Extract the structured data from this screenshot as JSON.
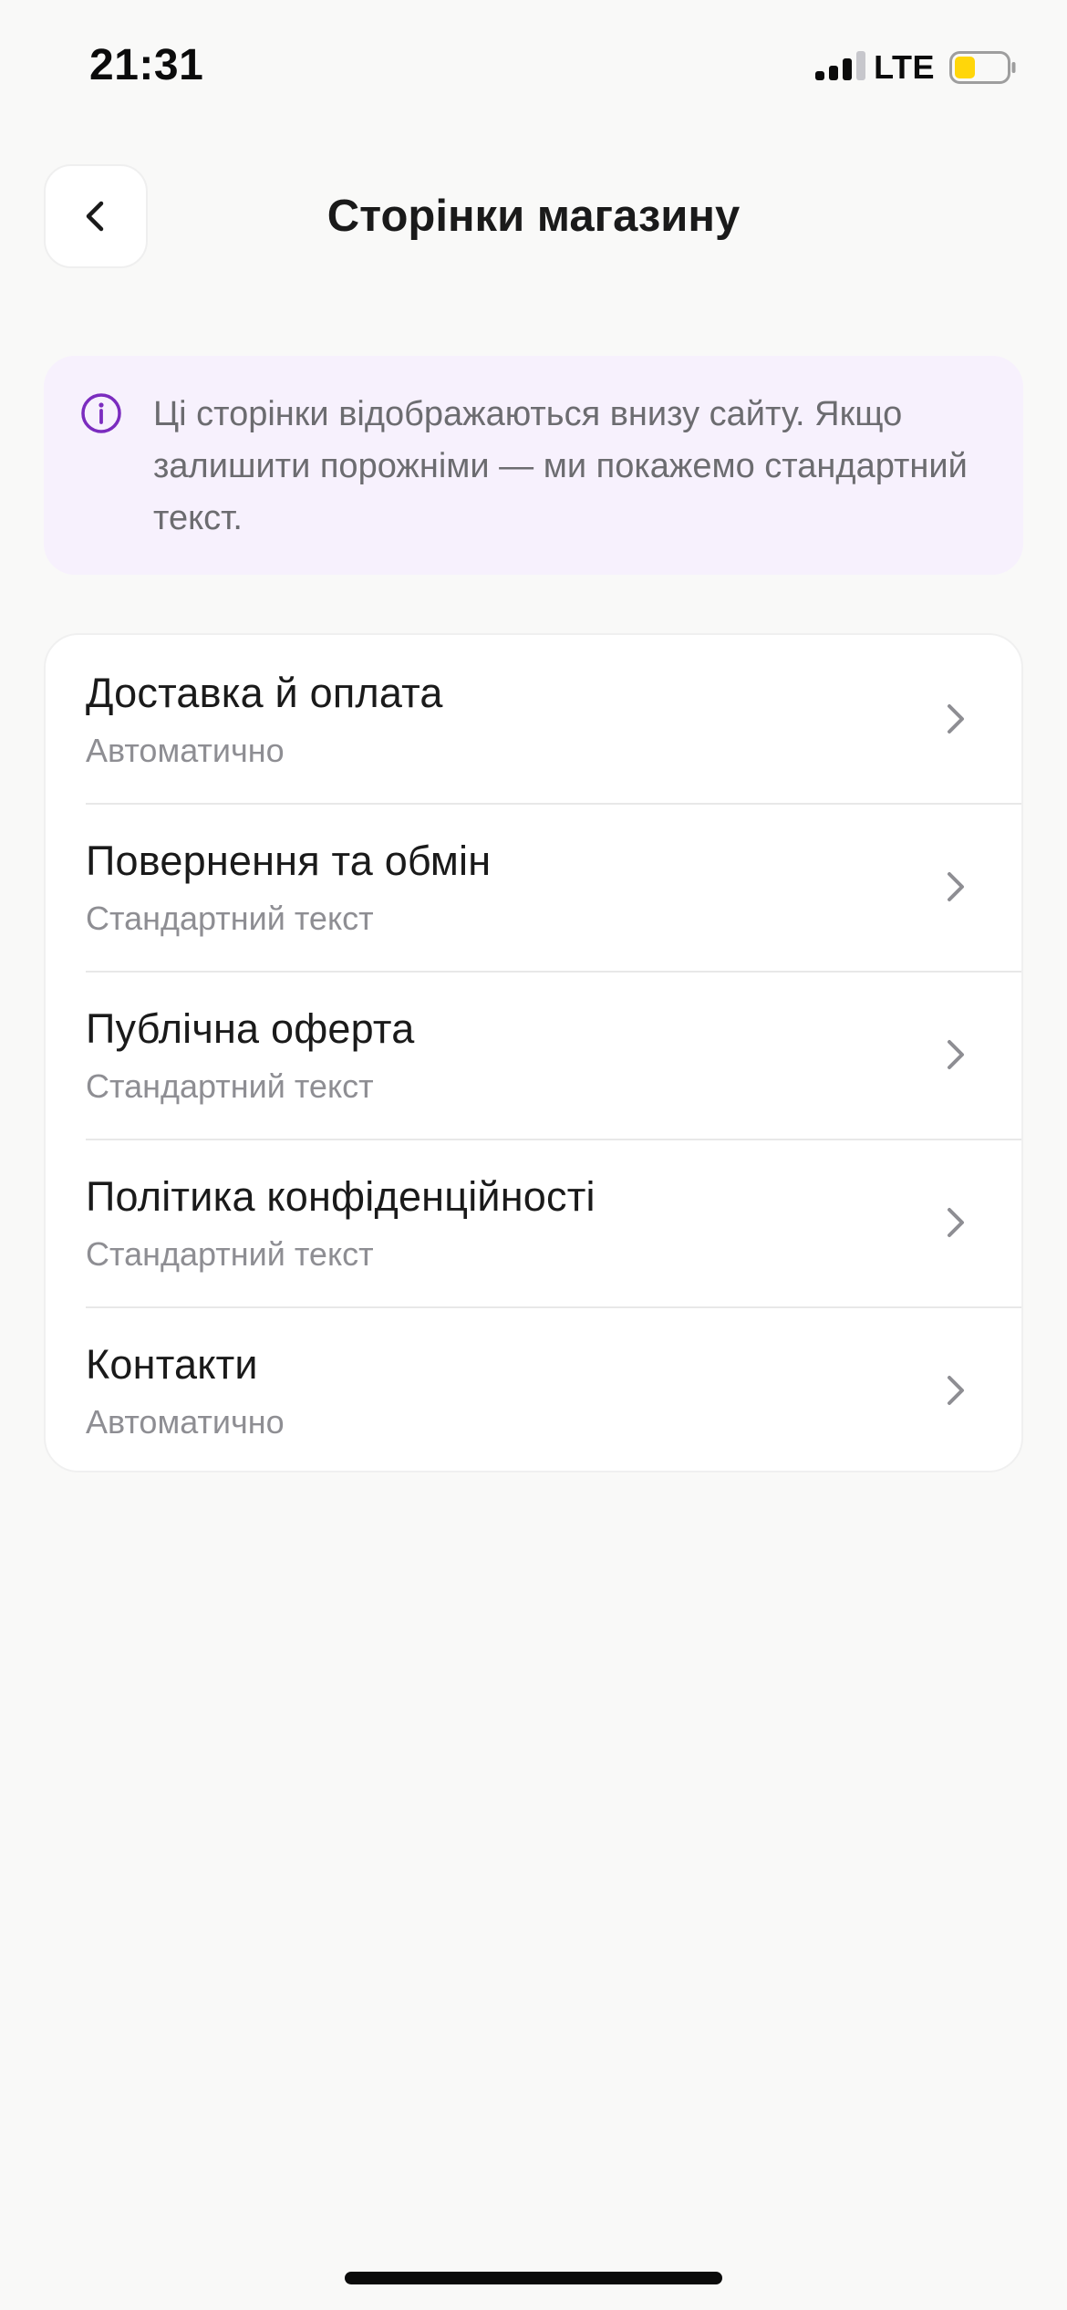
{
  "status_bar": {
    "time": "21:31",
    "network": "LTE",
    "icons": [
      "signal-icon",
      "battery-icon"
    ],
    "battery_color": "#FFD60A"
  },
  "header": {
    "back_icon": "chevron-left-icon",
    "title": "Сторінки магазину"
  },
  "info_banner": {
    "icon": "info-icon",
    "text": "Ці сторінки відображаються внизу сайту. Якщо залишити порожніми — ми покажемо стандартний текст.",
    "accent_color": "#7B2CBF",
    "background_color": "#F7F1FD"
  },
  "pages": [
    {
      "title": "Доставка й оплата",
      "subtitle": "Автоматично"
    },
    {
      "title": "Повернення та обмін",
      "subtitle": "Стандартний текст"
    },
    {
      "title": "Публічна оферта",
      "subtitle": "Стандартний текст"
    },
    {
      "title": "Політика конфіденційності",
      "subtitle": "Стандартний текст"
    },
    {
      "title": "Контакти",
      "subtitle": "Автоматично"
    }
  ],
  "item_icon": "chevron-right-icon"
}
